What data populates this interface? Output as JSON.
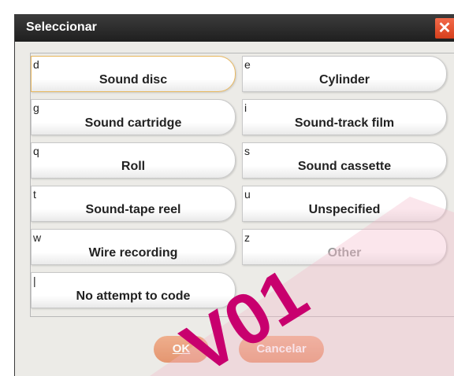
{
  "window": {
    "title": "Seleccionar",
    "close_glyph": "✕"
  },
  "options": [
    {
      "code": "d",
      "label": "Sound disc"
    },
    {
      "code": "e",
      "label": "Cylinder"
    },
    {
      "code": "g",
      "label": "Sound cartridge"
    },
    {
      "code": "i",
      "label": "Sound-track film"
    },
    {
      "code": "q",
      "label": "Roll"
    },
    {
      "code": "s",
      "label": "Sound cassette"
    },
    {
      "code": "t",
      "label": "Sound-tape reel"
    },
    {
      "code": "u",
      "label": "Unspecified"
    },
    {
      "code": "w",
      "label": "Wire recording"
    },
    {
      "code": "z",
      "label": "Other"
    },
    {
      "code": "|",
      "label": "No attempt to code"
    }
  ],
  "buttons": {
    "ok": "OK",
    "cancel": "Cancelar"
  },
  "watermark": {
    "text": "V01",
    "color": "#c8006e"
  }
}
